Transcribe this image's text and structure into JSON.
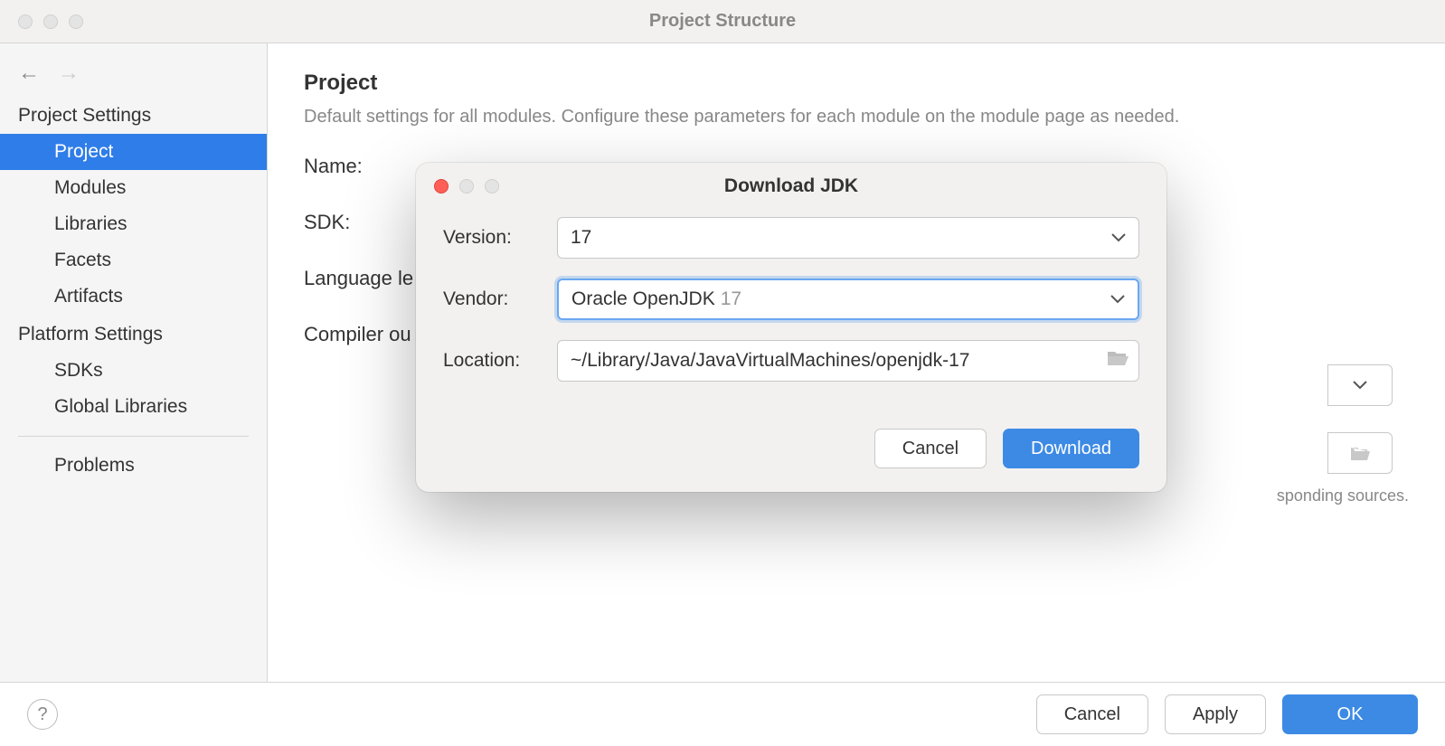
{
  "window": {
    "title": "Project Structure"
  },
  "sidebar": {
    "section1": "Project Settings",
    "items1": [
      "Project",
      "Modules",
      "Libraries",
      "Facets",
      "Artifacts"
    ],
    "section2": "Platform Settings",
    "items2": [
      "SDKs",
      "Global Libraries"
    ],
    "items3": [
      "Problems"
    ],
    "selected": "Project"
  },
  "content": {
    "title": "Project",
    "subtitle": "Default settings for all modules. Configure these parameters for each module on the module page as needed.",
    "labels": {
      "name": "Name:",
      "sdk": "SDK:",
      "language": "Language le",
      "compiler": "Compiler ou"
    },
    "hint_fragment": "sponding sources."
  },
  "modal": {
    "title": "Download JDK",
    "labels": {
      "version": "Version:",
      "vendor": "Vendor:",
      "location": "Location:"
    },
    "values": {
      "version": "17",
      "vendor_name": "Oracle OpenJDK",
      "vendor_version": "17",
      "location": "~/Library/Java/JavaVirtualMachines/openjdk-17"
    },
    "buttons": {
      "cancel": "Cancel",
      "download": "Download"
    }
  },
  "footer": {
    "cancel": "Cancel",
    "apply": "Apply",
    "ok": "OK",
    "help": "?"
  }
}
